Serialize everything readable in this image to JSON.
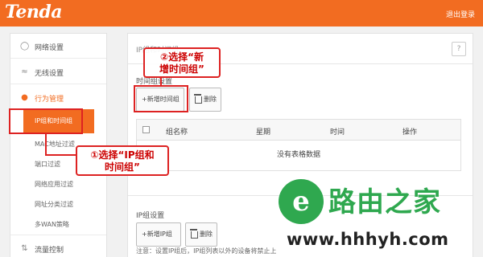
{
  "header": {
    "logo": "Tenda",
    "logout": "退出登录"
  },
  "sidebar": {
    "items": [
      {
        "label": "网络设置",
        "icon": "globe-icon"
      },
      {
        "label": "无线设置",
        "icon": "wifi-icon"
      },
      {
        "label": "行为管理",
        "icon": "user-icon"
      },
      {
        "label": "流量控制",
        "icon": "traffic-icon"
      }
    ],
    "sub_items": [
      {
        "label": "IP组和时间组"
      },
      {
        "label": "MAC地址过滤"
      },
      {
        "label": "端口过滤"
      },
      {
        "label": "网络应用过滤"
      },
      {
        "label": "网址分类过滤"
      },
      {
        "label": "多WAN策略"
      }
    ]
  },
  "main": {
    "panel_title": "IP组和时间组",
    "help": "?",
    "time_group": {
      "label": "时间组设置",
      "add_button": "+新增时间组",
      "delete_button": "删除",
      "columns": [
        "组名称",
        "星期",
        "时间",
        "操作"
      ],
      "empty": "没有表格数据"
    },
    "ip_group": {
      "label": "IP组设置",
      "add_button": "+新增IP组",
      "delete_button": "删除"
    },
    "note": "注意：设置IP组后，IP组列表以外的设备将禁止上"
  },
  "annotations": {
    "step1": "①选择“IP组和\n时间组”",
    "step2": "②选择“新\n增时间组”",
    "color": "#dd2222"
  },
  "watermark": {
    "icon": "e",
    "brand": "路由之家",
    "url": "www.hhhyh.com"
  },
  "colors": {
    "accent": "#f26c21",
    "watermark": "#2fa84f"
  }
}
